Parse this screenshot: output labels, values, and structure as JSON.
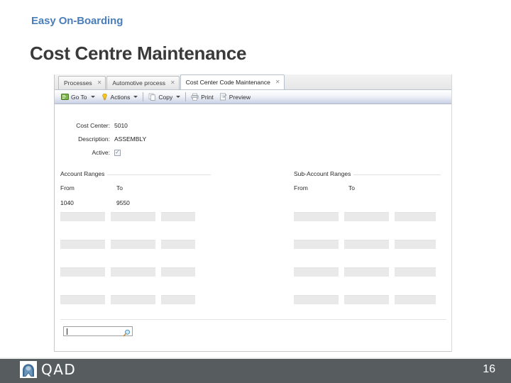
{
  "slide": {
    "kicker": "Easy On-Boarding",
    "title": "Cost Centre Maintenance",
    "page_number": "16",
    "accent_color": "#4a7ebb",
    "title_color": "#3a3a3a",
    "footer_color": "#575c5f"
  },
  "app": {
    "tabs": [
      {
        "label": "Processes",
        "active": false,
        "close": "✕"
      },
      {
        "label": "Automotive process",
        "active": false,
        "close": "✕"
      },
      {
        "label": "Cost Center Code Maintenance",
        "active": true,
        "close": "✕"
      }
    ],
    "toolbar": [
      {
        "label": "Go To",
        "icon": "goto-icon",
        "dropdown": true
      },
      {
        "label": "Actions",
        "icon": "actions-icon",
        "dropdown": true
      },
      {
        "label": "Copy",
        "icon": "copy-icon",
        "dropdown": true
      },
      {
        "label": "Print",
        "icon": "print-icon",
        "dropdown": false
      },
      {
        "label": "Preview",
        "icon": "preview-icon",
        "dropdown": false
      }
    ],
    "form": {
      "cost_center_label": "Cost Center:",
      "cost_center_value": "5010",
      "description_label": "Description:",
      "description_value": "ASSEMBLY",
      "active_label": "Active:",
      "active_checked": "✓"
    },
    "account_ranges": {
      "title": "Account Ranges",
      "from_header": "From",
      "to_header": "To",
      "from_value": "1040",
      "to_value": "9550"
    },
    "sub_account_ranges": {
      "title": "Sub-Account Ranges",
      "from_header": "From",
      "to_header": "To",
      "from_value": "",
      "to_value": ""
    },
    "search": {
      "value": "",
      "placeholder": "",
      "icon": "magnifier-icon"
    }
  },
  "logo": {
    "text": "QAD"
  }
}
